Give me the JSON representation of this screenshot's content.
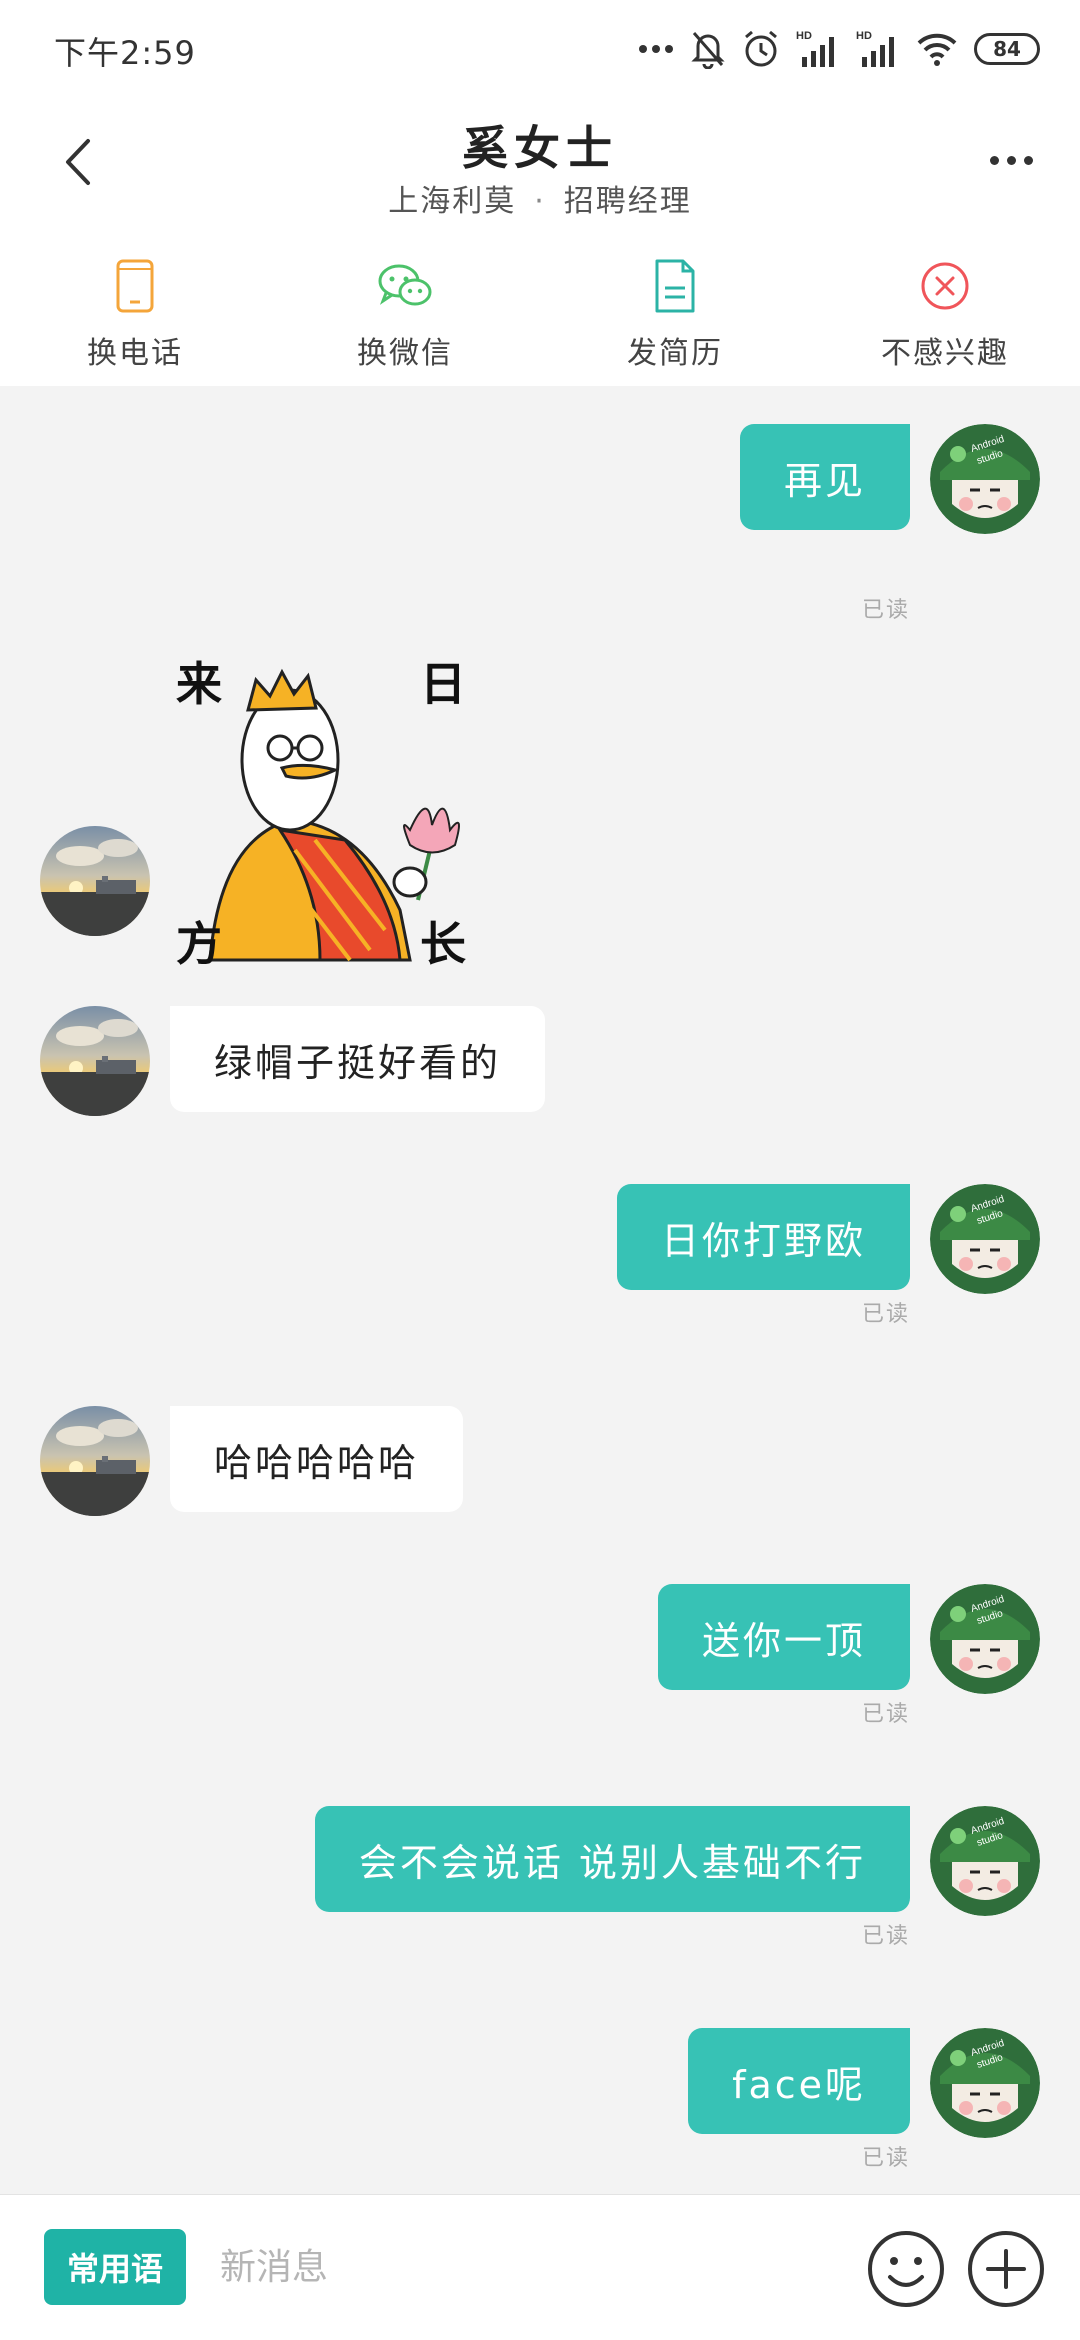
{
  "status_bar": {
    "time": "下午2:59",
    "battery": "84",
    "icons": [
      "more-dots-icon",
      "mute-bell-icon",
      "alarm-icon",
      "signal-hd-icon",
      "signal-hd-icon",
      "wifi-icon",
      "battery-icon"
    ]
  },
  "header": {
    "title": "奚女士",
    "company": "上海利莫",
    "separator": "·",
    "role": "招聘经理"
  },
  "actions": [
    {
      "label": "换电话",
      "icon": "phone-icon",
      "color": "#f4a53a"
    },
    {
      "label": "换微信",
      "icon": "wechat-icon",
      "color": "#4cc26a"
    },
    {
      "label": "发简历",
      "icon": "resume-icon",
      "color": "#2bb3a6"
    },
    {
      "label": "不感兴趣",
      "icon": "not-interested-icon",
      "color": "#f0555a"
    }
  ],
  "sticker": {
    "chars": [
      "来",
      "日",
      "方",
      "长"
    ]
  },
  "messages": [
    {
      "from": "me",
      "text": "再见",
      "status": "已读"
    },
    {
      "from": "them",
      "type": "sticker"
    },
    {
      "from": "them",
      "text": "绿帽子挺好看的"
    },
    {
      "from": "me",
      "text": "日你打野欧",
      "status": "已读"
    },
    {
      "from": "them",
      "text": "哈哈哈哈哈"
    },
    {
      "from": "me",
      "text": "送你一顶",
      "status": "已读"
    },
    {
      "from": "me",
      "text": "会不会说话 说别人基础不行",
      "status": "已读"
    },
    {
      "from": "me",
      "text": "face呢",
      "status": "已读"
    }
  ],
  "my_avatar": {
    "text": "Android studio"
  },
  "input_bar": {
    "phrases_label": "常用语",
    "placeholder": "新消息",
    "value": ""
  },
  "colors": {
    "accent": "#37c2b5",
    "phrases_button": "#1fb3a6",
    "background": "#f3f3f3"
  }
}
